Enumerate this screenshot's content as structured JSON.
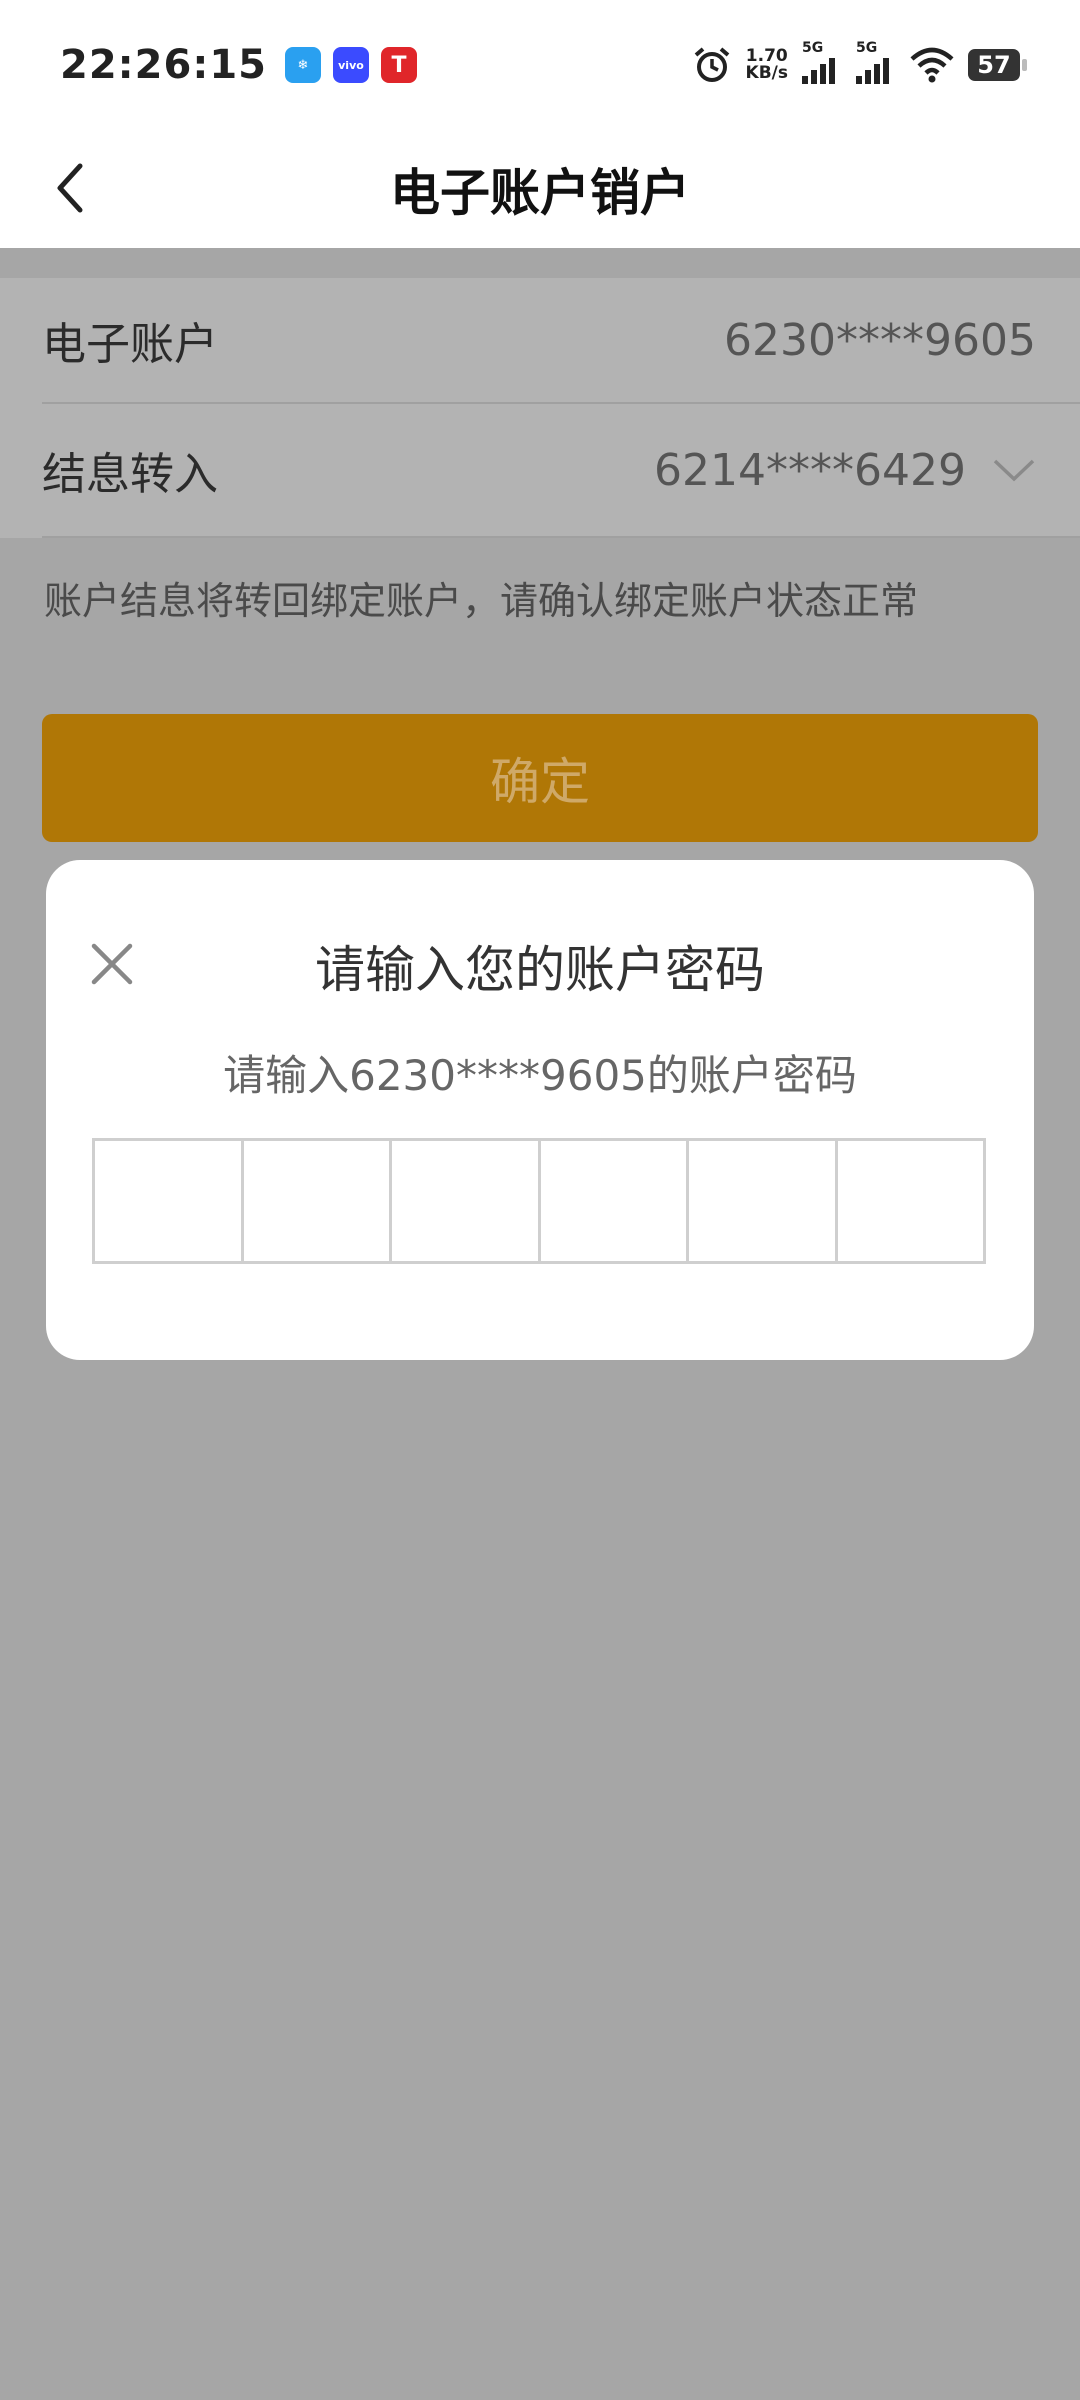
{
  "status_bar": {
    "time": "22:26:15",
    "net_speed_value": "1.70",
    "net_speed_unit": "KB/s",
    "sim1_label": "5G",
    "sim2_label": "5G",
    "battery": "57",
    "app_icons": [
      "app-icon-blue",
      "vivo-icon",
      "red-t-app-icon"
    ]
  },
  "header": {
    "title": "电子账户销户"
  },
  "form": {
    "account_label": "电子账户",
    "account_value": "6230****9605",
    "interest_label": "结息转入",
    "interest_value": "6214****6429",
    "hint": "账户结息将转回绑定账户，请确认绑定账户状态正常",
    "confirm_label": "确定"
  },
  "dialog": {
    "title": "请输入您的账户密码",
    "subtitle": "请输入6230****9605的账户密码",
    "pin_length": 6
  }
}
